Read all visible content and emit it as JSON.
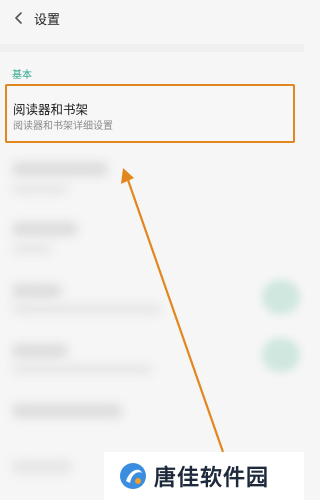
{
  "header": {
    "back_icon": "chevron-left-icon",
    "title": "设置"
  },
  "section": {
    "label": "基本"
  },
  "highlight_row": {
    "title": "阅读器和书架",
    "subtitle": "阅读器和书架详细设置",
    "highlight_color": "#e2861f"
  },
  "annotation": {
    "arrow_color": "#e2861f"
  },
  "watermark": {
    "text": "唐佳软件园",
    "logo_icon": "swirl-logo-icon"
  },
  "colors": {
    "accent": "#2aa68a",
    "background": "#f6f6f6"
  }
}
